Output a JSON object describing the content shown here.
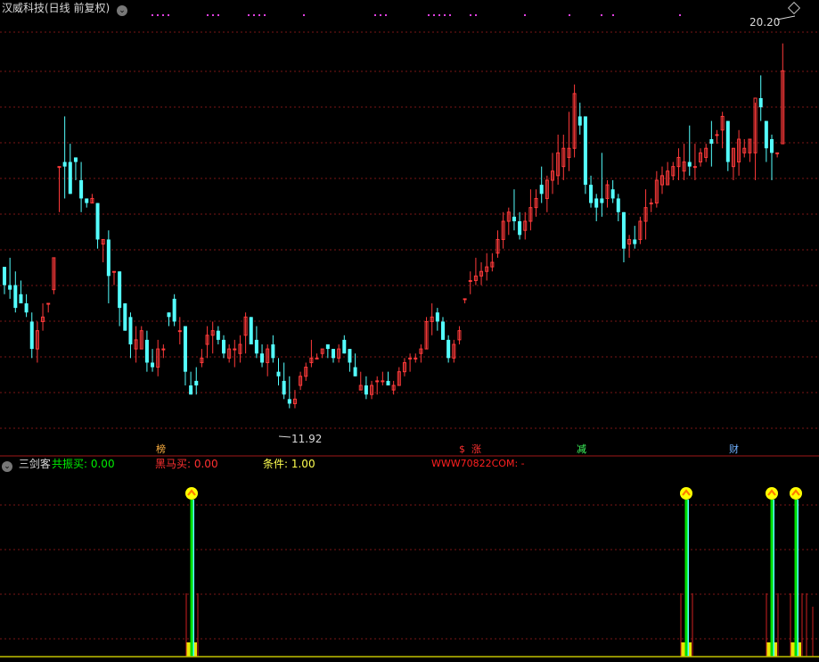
{
  "colors": {
    "background": "#000000",
    "grid": "#7a1616",
    "up": "#ff3a3a",
    "down": "#54ffff",
    "title": "#d8d8d8",
    "green_text": "#00ee00",
    "red_text": "#ff3030",
    "yellow_text": "#ffff50",
    "url_text": "#ff2020",
    "magenta_dots": "#e040e0",
    "arrow_yellow": "#ffff00",
    "arrow_orange": "#ff7a00"
  },
  "top_panel": {
    "title": "汉威科技(日线 前复权)",
    "collapse_icon": "chevron-down-icon",
    "corner_icon": "diamond-icon"
  },
  "bottom_panel": {
    "indicator_name": "三剑客",
    "lines": [
      {
        "label": "共振买: 0.00",
        "color": "#00ee00"
      },
      {
        "label": "黑马买: 0.00",
        "color": "#ff3030"
      },
      {
        "label": "条件: 1.00",
        "color": "#ffff50"
      },
      {
        "label": "WWW70822COM: -",
        "color": "#ff2020"
      }
    ]
  },
  "chart_data": [
    {
      "type": "candlestick",
      "title": "汉威科技(日线 前复权)",
      "y_range": [
        11.5,
        20.5
      ],
      "annotations": [
        {
          "text": "20.20",
          "value": 20.2,
          "kind": "max"
        },
        {
          "text": "11.92",
          "value": 11.92,
          "kind": "min"
        }
      ],
      "event_markers": [
        {
          "text": "榜",
          "color": "#ffb040"
        },
        {
          "text": "$",
          "color": "#ff3030"
        },
        {
          "text": "涨",
          "color": "#ff3030"
        },
        {
          "text": "减",
          "color": "#40ff60"
        },
        {
          "text": "财",
          "color": "#70b0ff"
        }
      ],
      "candles": [
        [
          15.0,
          15.0,
          14.4,
          14.6
        ],
        [
          14.6,
          15.2,
          14.3,
          14.5
        ],
        [
          14.6,
          14.9,
          14.0,
          14.1
        ],
        [
          14.4,
          14.7,
          14.2,
          14.2
        ],
        [
          14.2,
          14.4,
          13.9,
          14.0
        ],
        [
          13.8,
          14.0,
          13.0,
          13.2
        ],
        [
          13.2,
          13.8,
          12.9,
          13.6
        ],
        [
          13.8,
          14.2,
          13.6,
          13.9
        ],
        [
          14.2,
          14.2,
          14.0,
          14.2
        ],
        [
          14.5,
          15.2,
          14.4,
          15.2
        ],
        [
          17.2,
          17.2,
          16.2,
          17.2
        ],
        [
          17.3,
          18.3,
          16.5,
          17.2
        ],
        [
          17.3,
          17.7,
          16.6,
          16.6
        ],
        [
          17.4,
          17.4,
          16.9,
          17.3
        ],
        [
          16.9,
          17.3,
          16.2,
          16.5
        ],
        [
          16.5,
          16.5,
          16.3,
          16.4
        ],
        [
          16.4,
          16.6,
          16.4,
          16.5
        ],
        [
          16.4,
          16.4,
          15.4,
          15.6
        ],
        [
          15.5,
          15.6,
          15.1,
          15.6
        ],
        [
          15.6,
          15.8,
          14.2,
          14.8
        ],
        [
          14.9,
          14.9,
          14.6,
          14.9
        ],
        [
          14.9,
          14.9,
          13.7,
          14.1
        ],
        [
          14.2,
          14.2,
          13.6,
          13.6
        ],
        [
          13.9,
          14.0,
          13.0,
          13.3
        ],
        [
          13.2,
          13.7,
          12.9,
          13.4
        ],
        [
          13.2,
          13.7,
          13.2,
          13.6
        ],
        [
          13.4,
          13.6,
          12.7,
          12.9
        ],
        [
          12.9,
          13.2,
          12.7,
          12.8
        ],
        [
          12.8,
          13.4,
          12.6,
          13.2
        ],
        [
          13.2,
          13.3,
          13.0,
          13.2
        ],
        [
          14.0,
          14.0,
          13.7,
          13.9
        ],
        [
          14.3,
          14.4,
          13.7,
          13.8
        ],
        [
          13.6,
          13.9,
          13.3,
          13.6
        ],
        [
          13.7,
          13.7,
          12.4,
          12.7
        ],
        [
          12.4,
          12.7,
          12.2,
          12.2
        ],
        [
          12.5,
          12.8,
          12.2,
          12.4
        ],
        [
          12.9,
          13.2,
          12.8,
          13.0
        ],
        [
          13.3,
          13.7,
          13.0,
          13.5
        ],
        [
          13.5,
          13.8,
          13.1,
          13.6
        ],
        [
          13.6,
          13.7,
          13.3,
          13.4
        ],
        [
          13.4,
          13.5,
          13.0,
          13.1
        ],
        [
          13.0,
          13.3,
          12.9,
          13.2
        ],
        [
          13.2,
          13.4,
          12.8,
          13.2
        ],
        [
          13.1,
          13.5,
          12.9,
          13.3
        ],
        [
          13.5,
          14.0,
          13.1,
          13.9
        ],
        [
          13.9,
          13.9,
          13.3,
          13.3
        ],
        [
          13.4,
          13.7,
          13.0,
          13.1
        ],
        [
          13.1,
          13.3,
          12.8,
          12.9
        ],
        [
          12.9,
          13.3,
          12.6,
          13.2
        ],
        [
          13.3,
          13.5,
          12.9,
          13.0
        ],
        [
          12.7,
          13.0,
          12.4,
          12.6
        ],
        [
          12.5,
          12.9,
          12.1,
          12.2
        ],
        [
          12.1,
          12.6,
          11.9,
          12.0
        ],
        [
          12.0,
          12.3,
          11.9,
          12.1
        ],
        [
          12.4,
          12.7,
          12.3,
          12.6
        ],
        [
          12.6,
          12.9,
          12.5,
          12.8
        ],
        [
          12.9,
          13.4,
          12.8,
          13.0
        ],
        [
          13.0,
          13.1,
          13.0,
          13.0
        ],
        [
          13.1,
          13.2,
          13.0,
          13.2
        ],
        [
          13.3,
          13.3,
          13.0,
          13.2
        ],
        [
          13.2,
          13.2,
          12.9,
          13.0
        ],
        [
          13.0,
          13.3,
          12.9,
          13.2
        ],
        [
          13.4,
          13.5,
          13.1,
          13.1
        ],
        [
          13.2,
          13.2,
          12.7,
          12.9
        ],
        [
          12.8,
          13.1,
          12.6,
          12.6
        ],
        [
          12.3,
          12.7,
          12.3,
          12.4
        ],
        [
          12.4,
          12.6,
          12.1,
          12.2
        ],
        [
          12.2,
          12.5,
          12.1,
          12.4
        ],
        [
          12.5,
          12.6,
          12.2,
          12.5
        ],
        [
          12.5,
          12.7,
          12.4,
          12.5
        ],
        [
          12.5,
          12.7,
          12.4,
          12.4
        ],
        [
          12.3,
          12.5,
          12.2,
          12.4
        ],
        [
          12.4,
          12.8,
          12.4,
          12.7
        ],
        [
          12.7,
          13.0,
          12.6,
          12.9
        ],
        [
          13.0,
          13.1,
          12.7,
          13.0
        ],
        [
          13.0,
          13.1,
          12.9,
          13.0
        ],
        [
          13.1,
          13.3,
          12.9,
          13.2
        ],
        [
          13.2,
          13.9,
          13.2,
          13.8
        ],
        [
          13.8,
          14.2,
          13.5,
          13.9
        ],
        [
          14.0,
          14.1,
          13.6,
          13.8
        ],
        [
          13.8,
          13.9,
          13.4,
          13.4
        ],
        [
          13.4,
          13.5,
          12.9,
          13.0
        ],
        [
          13.0,
          13.4,
          12.9,
          13.3
        ],
        [
          13.4,
          13.7,
          13.3,
          13.6
        ],
        [
          14.3,
          14.3,
          14.2,
          14.3
        ],
        [
          14.7,
          14.9,
          14.4,
          14.7
        ],
        [
          14.7,
          15.2,
          14.6,
          14.8
        ],
        [
          14.8,
          15.1,
          14.6,
          14.9
        ],
        [
          14.9,
          15.3,
          14.7,
          15.0
        ],
        [
          15.0,
          15.3,
          14.9,
          15.1
        ],
        [
          15.3,
          15.8,
          15.2,
          15.6
        ],
        [
          15.6,
          16.2,
          15.4,
          16.0
        ],
        [
          16.0,
          16.3,
          15.7,
          16.2
        ],
        [
          16.1,
          16.7,
          15.8,
          16.0
        ],
        [
          16.0,
          16.2,
          15.6,
          15.7
        ],
        [
          15.8,
          16.2,
          15.6,
          16.0
        ],
        [
          16.0,
          16.7,
          15.8,
          16.3
        ],
        [
          16.3,
          16.7,
          16.1,
          16.5
        ],
        [
          16.8,
          17.2,
          16.4,
          16.6
        ],
        [
          16.5,
          17.0,
          16.2,
          16.9
        ],
        [
          16.9,
          17.5,
          16.6,
          17.1
        ],
        [
          17.0,
          17.9,
          16.8,
          17.5
        ],
        [
          17.2,
          17.9,
          16.9,
          17.6
        ],
        [
          17.4,
          18.4,
          17.1,
          17.6
        ],
        [
          17.6,
          19.0,
          17.4,
          18.8
        ],
        [
          18.3,
          18.6,
          17.9,
          18.1
        ],
        [
          18.3,
          18.3,
          16.6,
          16.8
        ],
        [
          16.8,
          17.0,
          16.3,
          16.4
        ],
        [
          16.5,
          16.6,
          16.0,
          16.3
        ],
        [
          16.5,
          17.5,
          16.1,
          16.4
        ],
        [
          16.5,
          16.9,
          16.3,
          16.8
        ],
        [
          16.7,
          16.9,
          16.4,
          16.5
        ],
        [
          16.5,
          16.6,
          16.0,
          16.2
        ],
        [
          16.2,
          16.2,
          15.1,
          15.4
        ],
        [
          15.5,
          15.7,
          15.2,
          15.6
        ],
        [
          15.6,
          15.9,
          15.4,
          15.5
        ],
        [
          15.6,
          16.1,
          15.5,
          16.0
        ],
        [
          16.0,
          16.7,
          15.6,
          16.3
        ],
        [
          16.4,
          16.5,
          16.2,
          16.4
        ],
        [
          16.4,
          17.1,
          16.3,
          16.9
        ],
        [
          16.8,
          17.2,
          16.6,
          17.0
        ],
        [
          16.8,
          17.3,
          16.8,
          17.1
        ],
        [
          17.0,
          17.3,
          16.9,
          17.2
        ],
        [
          17.2,
          17.6,
          16.9,
          17.4
        ],
        [
          17.1,
          17.7,
          16.9,
          17.3
        ],
        [
          17.3,
          18.1,
          17.0,
          17.2
        ],
        [
          17.2,
          17.7,
          16.9,
          17.2
        ],
        [
          17.3,
          17.6,
          17.2,
          17.5
        ],
        [
          17.4,
          17.7,
          17.3,
          17.6
        ],
        [
          17.8,
          18.2,
          17.2,
          17.7
        ],
        [
          17.9,
          18.0,
          17.7,
          17.9
        ],
        [
          18.0,
          18.4,
          17.6,
          18.3
        ],
        [
          18.2,
          18.2,
          17.1,
          17.3
        ],
        [
          17.2,
          17.6,
          16.9,
          17.6
        ],
        [
          17.3,
          18.0,
          17.0,
          17.8
        ],
        [
          17.5,
          17.8,
          17.4,
          17.6
        ],
        [
          17.5,
          17.8,
          17.3,
          17.8
        ],
        [
          17.5,
          18.6,
          16.9,
          18.7
        ],
        [
          18.7,
          19.2,
          18.2,
          18.5
        ],
        [
          18.2,
          18.2,
          17.3,
          17.6
        ],
        [
          17.8,
          17.9,
          16.9,
          17.5
        ],
        [
          17.5,
          17.5,
          17.4,
          17.5
        ],
        [
          17.7,
          19.9,
          17.7,
          19.3
        ]
      ]
    },
    {
      "type": "signal-bars",
      "series": [
        {
          "name": "共振买",
          "value": 0.0
        },
        {
          "name": "黑马买",
          "value": 0.0
        },
        {
          "name": "条件",
          "value": 1.0
        },
        {
          "name": "WWW70822COM",
          "value": null
        }
      ]
    }
  ]
}
